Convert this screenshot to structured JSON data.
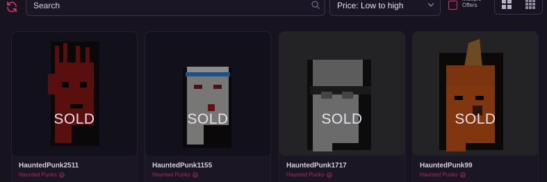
{
  "search": {
    "placeholder": "Search"
  },
  "sort": {
    "selected": "Price: Low to high"
  },
  "multiple_offers": {
    "label": "Multiple Offers",
    "checked": false
  },
  "view_toggle": {
    "options": [
      "large-grid-icon",
      "small-grid-icon"
    ]
  },
  "colors": {
    "accent": "#d2386c",
    "background": "#17131f"
  },
  "items": [
    {
      "name": "HauntedPunk2511",
      "collection": "Haunted Punks",
      "status": "SOLD"
    },
    {
      "name": "HauntedPunk1155",
      "collection": "Haunted Punks",
      "status": "SOLD"
    },
    {
      "name": "HauntedPunk1717",
      "collection": "Haunted Punks",
      "status": "SOLD"
    },
    {
      "name": "HauntedPunk99",
      "collection": "Haunted Punks",
      "status": "SOLD"
    }
  ]
}
